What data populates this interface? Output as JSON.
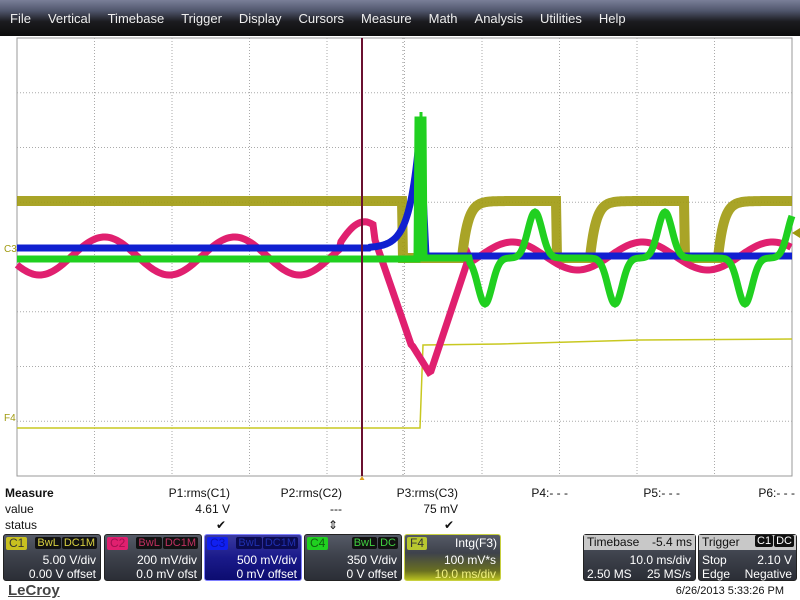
{
  "menu": [
    "File",
    "Vertical",
    "Timebase",
    "Trigger",
    "Display",
    "Cursors",
    "Measure",
    "Math",
    "Analysis",
    "Utilities",
    "Help"
  ],
  "markers": {
    "c_left": "C3",
    "f4": "F4"
  },
  "colors": {
    "C1": "#a09a10",
    "C2": "#e0206f",
    "C3": "#1020d0",
    "C4": "#20d020",
    "F4": "#c8c820",
    "cursor": "#6a1030",
    "trigger": "#e0a020"
  },
  "measure": {
    "title": "Measure",
    "row_value": "value",
    "row_status": "status",
    "params": [
      {
        "name": "P1:rms(C1)",
        "value": "4.61 V",
        "status": "✔"
      },
      {
        "name": "P2:rms(C2)",
        "value": "---",
        "status": "⇕"
      },
      {
        "name": "P3:rms(C3)",
        "value": "75 mV",
        "status": "✔"
      },
      {
        "name": "P4:- - -",
        "value": "",
        "status": ""
      },
      {
        "name": "P5:- - -",
        "value": "",
        "status": ""
      },
      {
        "name": "P6:- - -",
        "value": "",
        "status": ""
      }
    ]
  },
  "channels": [
    {
      "tag": "C1",
      "flags": [
        "BwL",
        "DC1M"
      ],
      "vdiv": "5.00 V/div",
      "offset": "0.00 V offset"
    },
    {
      "tag": "C2",
      "flags": [
        "BwL",
        "DC1M"
      ],
      "vdiv": "200 mV/div",
      "offset": "0.0 mV ofst"
    },
    {
      "tag": "C3",
      "flags": [
        "BwL",
        "DC1M"
      ],
      "vdiv": "500 mV/div",
      "offset": "0 mV offset"
    },
    {
      "tag": "C4",
      "flags": [
        "BwL",
        "DC"
      ],
      "vdiv": "350 V/div",
      "offset": "0 V offset"
    }
  ],
  "math": {
    "tag": "F4",
    "func": "Intg(F3)",
    "scale": "100 mV*s",
    "tdiv": "10.0 ms/div"
  },
  "timebase": {
    "label": "Timebase",
    "delay": "-5.4 ms",
    "tdiv": "10.0 ms/div",
    "samples": "2.50 MS",
    "rate": "25 MS/s"
  },
  "trigger": {
    "label": "Trigger",
    "source": "C1",
    "coupling": "DC",
    "mode": "Stop",
    "level": "2.10 V",
    "type": "Edge",
    "slope": "Negative"
  },
  "logo": "LeCroy",
  "datetime": "6/26/2013 5:33:26 PM"
}
